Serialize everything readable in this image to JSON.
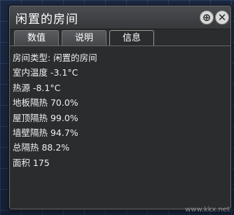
{
  "window": {
    "title": "闲置的房间",
    "pin_icon": "crosshair-icon",
    "close_icon": "close-icon"
  },
  "tabs": [
    {
      "label": "数值",
      "active": false
    },
    {
      "label": "说明",
      "active": false
    },
    {
      "label": "信息",
      "active": true
    }
  ],
  "info": {
    "rows": [
      "房间类型:  闲置的房间",
      "室内温度 -3.1°C",
      "热源 -8.1°C",
      "地板隔热 70.0%",
      "屋顶隔热 99.0%",
      "墙壁隔热 94.7%",
      "总隔热 88.2%",
      "面积 175"
    ]
  },
  "watermark": "www.kkx.net",
  "colors": {
    "panel_bg": "#2b2c2e",
    "text": "#f0f0f0",
    "background_grid": "#1b2a45"
  }
}
